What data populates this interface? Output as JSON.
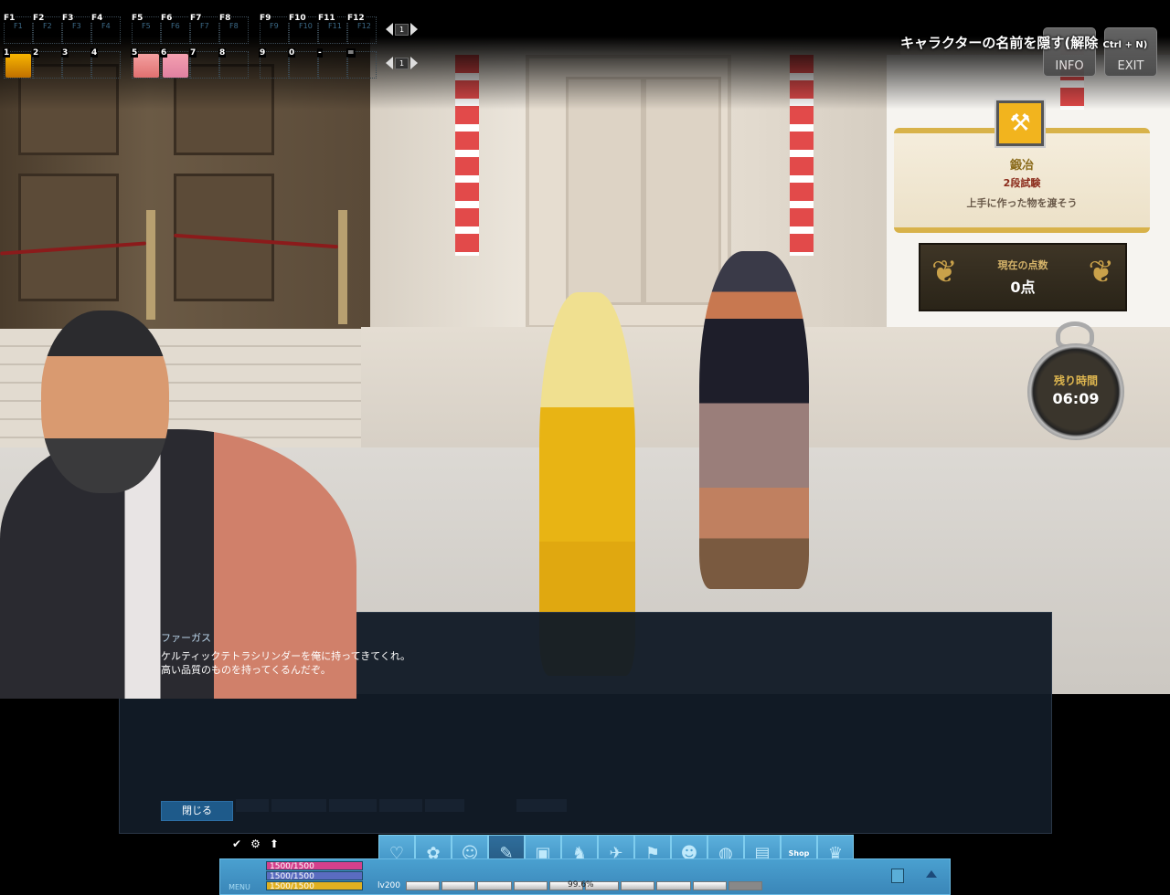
{
  "hotkeys": {
    "f_row": [
      "F1",
      "F2",
      "F3",
      "F4",
      "F5",
      "F6",
      "F7",
      "F8",
      "F9",
      "F10",
      "F11",
      "F12"
    ],
    "num_row": [
      "1",
      "2",
      "3",
      "4",
      "5",
      "6",
      "7",
      "8",
      "9",
      "0",
      "-",
      "="
    ],
    "top_page": "1",
    "bottom_page": "1",
    "slot_icons": {
      "1": "blacksmith-anvil-icon",
      "5": "pickaxe-icon",
      "6": "boots-icon"
    }
  },
  "top": {
    "hide_name": "キャラクターの名前を隠す(解除",
    "hide_name_shortcut": "Ctrl + N)",
    "info_label": "INFO",
    "exit_label": "EXIT"
  },
  "quest": {
    "title": "鍛冶",
    "subtitle": "2段試験",
    "description": "上手に作った物を渡そう",
    "icon": "anvil-hammer-icon"
  },
  "score": {
    "label": "現在の点数",
    "value": "0点"
  },
  "timer": {
    "label": "残り時間",
    "value": "06:09"
  },
  "dialog": {
    "npc_name": "ファーガス",
    "lines": [
      "ケルティックテトラシリンダーを俺に持ってきてくれ。",
      "高い品質のものを持ってくるんだぞ。"
    ],
    "close_label": "閉じる"
  },
  "bottom": {
    "menu_label": "MENU",
    "hp": "1500/1500",
    "mp": "1500/1500",
    "stamina": "1500/1500",
    "level": "lv200",
    "exp_percent": "99.6%",
    "colors": {
      "hp": "#d4408c",
      "mp": "#5a6cc0",
      "stamina": "#e0b020",
      "bar": "#3a86b8"
    },
    "icons": [
      "search-heart-icon",
      "clover-icon",
      "character-icon",
      "skill-scroll-icon",
      "inventory-bag-icon",
      "pet-icon",
      "action-icon",
      "guild-icon",
      "social-icon",
      "world-icon",
      "quest-book-icon",
      "shop-icon",
      "crown-icon"
    ],
    "shop_label": "Shop"
  }
}
